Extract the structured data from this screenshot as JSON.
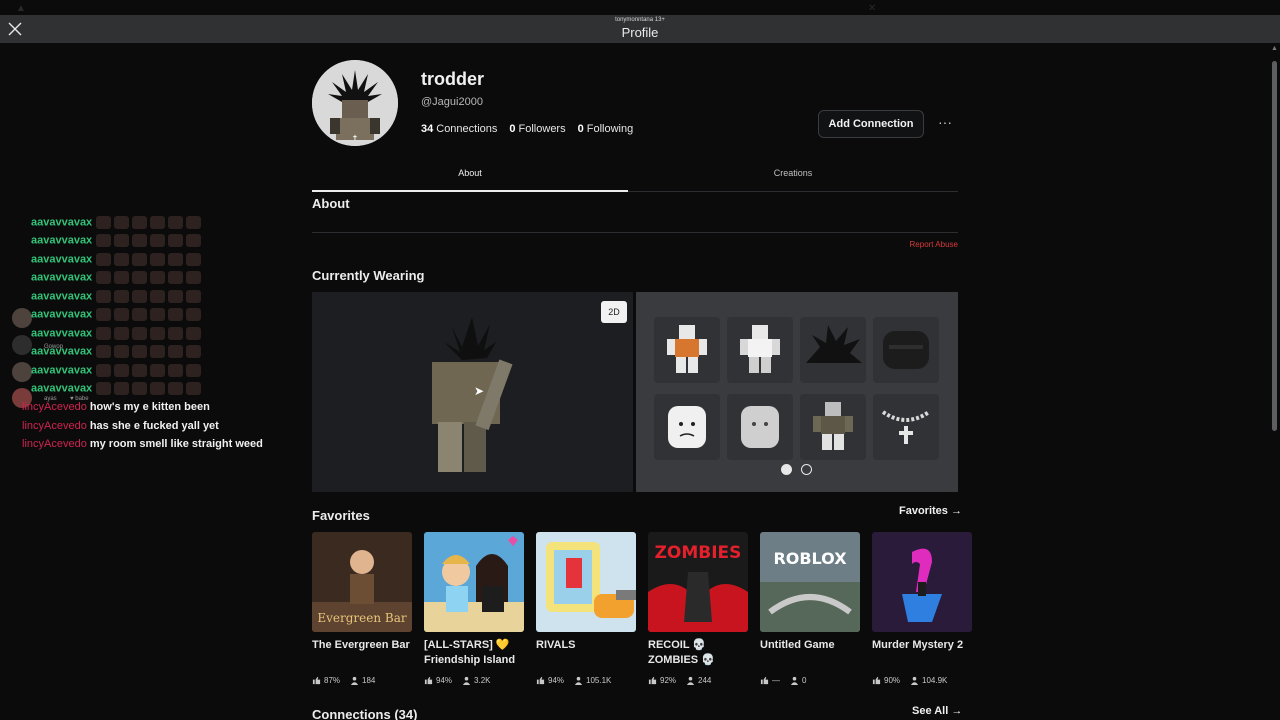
{
  "window": {
    "title": "Profile",
    "user_tag": "tonymonntana 13+"
  },
  "profile": {
    "display_name": "trodder",
    "username": "@Jagui2000",
    "connections_count": "34",
    "connections_label": "Connections",
    "followers_count": "0",
    "followers_label": "Followers",
    "following_count": "0",
    "following_label": "Following",
    "add_connection_label": "Add Connection",
    "more_label": "···"
  },
  "tabs": [
    {
      "label": "About",
      "active": true
    },
    {
      "label": "Creations",
      "active": false
    }
  ],
  "about": {
    "title": "About",
    "report_label": "Report Abuse"
  },
  "wearing": {
    "title": "Currently Wearing",
    "view_toggle": "2D",
    "items": [
      "orange-shirt",
      "white-shirt",
      "spiky-black-hair",
      "black-mask",
      "face-frown",
      "face-default",
      "camo-outfit",
      "cross-chain"
    ],
    "pages": 2,
    "current_page": 1
  },
  "favorites": {
    "title": "Favorites",
    "link_label": "Favorites →",
    "games": [
      {
        "name": "The Evergreen Bar",
        "rating": "87%",
        "players": "184",
        "thumb_text": "Evergreen Bar",
        "color": "#3a2a1f"
      },
      {
        "name": "[ALL-STARS] 💛 Friendship Island",
        "rating": "94%",
        "players": "3.2K",
        "thumb_text": "",
        "color": "#5aa7d8"
      },
      {
        "name": "RIVALS",
        "rating": "94%",
        "players": "105.1K",
        "thumb_text": "",
        "color": "#cfe3ee"
      },
      {
        "name": "RECOIL 💀 ZOMBIES 💀",
        "rating": "92%",
        "players": "244",
        "thumb_text": "ZOMBIES",
        "color": "#1a1a1a"
      },
      {
        "name": "Untitled Game",
        "rating": "—",
        "players": "0",
        "thumb_text": "ROBLOX",
        "color": "#6d7e86"
      },
      {
        "name": "Murder Mystery 2",
        "rating": "90%",
        "players": "104.9K",
        "thumb_text": "",
        "color": "#2a1b3a"
      }
    ]
  },
  "connections": {
    "title": "Connections (34)",
    "link_label": "See All →"
  },
  "chat": {
    "lines": [
      {
        "user": "aavavvavax",
        "text": "",
        "emotes": 6
      },
      {
        "user": "aavavvavax",
        "text": "",
        "emotes": 6
      },
      {
        "user": "aavavvavax",
        "text": "",
        "emotes": 6
      },
      {
        "user": "aavavvavax",
        "text": "",
        "emotes": 6
      },
      {
        "user": "aavavvavax",
        "text": "",
        "emotes": 6
      },
      {
        "user": "aavavvavax",
        "text": "",
        "emotes": 6
      },
      {
        "user": "aavavvavax",
        "text": "",
        "emotes": 6
      },
      {
        "user": "aavavvavax",
        "text": "",
        "emotes": 6
      },
      {
        "user": "aavavvavax",
        "text": "",
        "emotes": 6
      },
      {
        "user": "aavavvavax",
        "text": "",
        "emotes": 6
      },
      {
        "user": "lincyAcevedo",
        "text": "how's my e kitten been",
        "emotes": 0
      },
      {
        "user": "lincyAcevedo",
        "text": "has she e fucked yall yet",
        "emotes": 0
      },
      {
        "user": "lincyAcevedo",
        "text": "my room smell like straight weed",
        "emotes": 0
      }
    ],
    "badges": [
      "Gowop",
      "ayas",
      "♥ babe"
    ]
  },
  "colors": {
    "accent_green": "#33c479",
    "accent_pink": "#d0234f",
    "report_red": "#d83b3b",
    "panel_dark": "#1d1e21",
    "panel_light": "#393b3f"
  }
}
